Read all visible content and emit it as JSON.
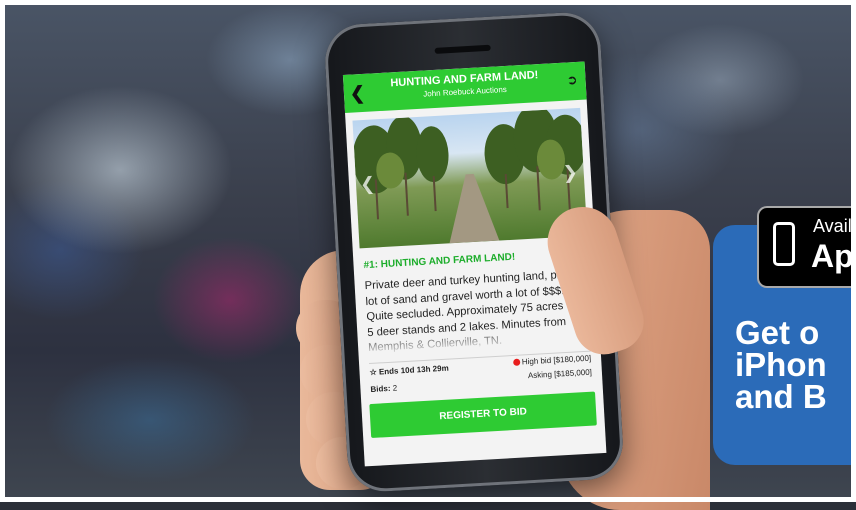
{
  "app_header": {
    "title": "HUNTING AND FARM LAND!",
    "subtitle": "John Roebuck Auctions"
  },
  "lot": {
    "title": "#1: HUNTING AND FARM LAND!",
    "description": "Private deer and turkey hunting land, plus a lot of sand and gravel worth a lot of $$$. Quite secluded. Approximately 75 acres with 5 deer stands and 2 lakes. Minutes from Memphis & Collierville, TN.",
    "ends": "Ends 10d 13h 29m",
    "bids_label": "Bids:",
    "bids_count": "2",
    "high_bid": "High bid [$180,000]",
    "asking": "Asking [$185,000]"
  },
  "register_button": "REGISTER TO BID",
  "promo": {
    "badge_small": "Avail",
    "badge_big": "Ap",
    "text": "Get o\niPhon\nand B"
  },
  "colors": {
    "app_green": "#2ecb33",
    "title_green": "#1dad2b",
    "promo_blue": "#2b6bb8",
    "high_bid_dot": "#e81d1d"
  },
  "icons": {
    "back": "chevron-left-icon",
    "logout": "logout-icon",
    "favorite": "star-outline-icon",
    "prev": "chevron-left-icon",
    "next": "chevron-right-icon",
    "app_store": "iphone-icon"
  }
}
